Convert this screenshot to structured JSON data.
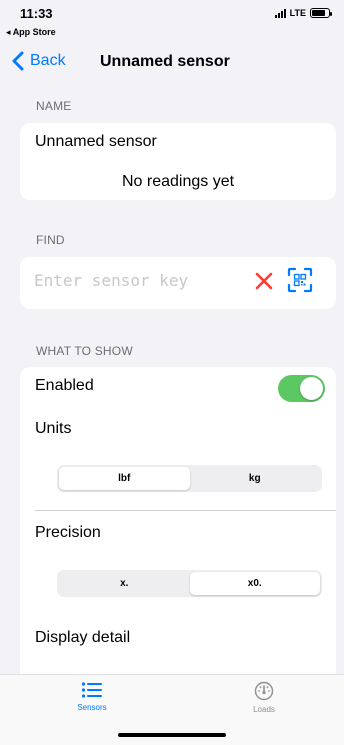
{
  "status_bar": {
    "time": "11:33",
    "back_app": "App Store",
    "network": "LTE"
  },
  "nav": {
    "back_label": "Back",
    "title": "Unnamed sensor"
  },
  "sections": {
    "name_header": "NAME",
    "find_header": "FIND",
    "show_header": "WHAT TO SHOW"
  },
  "name_card": {
    "sensor_name": "Unnamed sensor",
    "status_text": "No readings yet"
  },
  "find_card": {
    "placeholder": "Enter sensor key",
    "value": ""
  },
  "show_card": {
    "enabled_label": "Enabled",
    "enabled_on": true,
    "units_label": "Units",
    "units_options": [
      "lbf",
      "kg"
    ],
    "units_selected": "lbf",
    "precision_label": "Precision",
    "precision_options": [
      "x.",
      "x0."
    ],
    "precision_selected": "x0.",
    "display_detail_label": "Display detail"
  },
  "tab_bar": {
    "tabs": [
      {
        "label": "Sensors",
        "icon": "list-icon",
        "active": true
      },
      {
        "label": "Loads",
        "icon": "gauge-icon",
        "active": false
      }
    ]
  },
  "colors": {
    "accent": "#007AFF",
    "toggle_on": "#5CC864",
    "clear": "#FF3B30",
    "background": "#F2F2F7",
    "tab_inactive": "#8E8E93"
  }
}
